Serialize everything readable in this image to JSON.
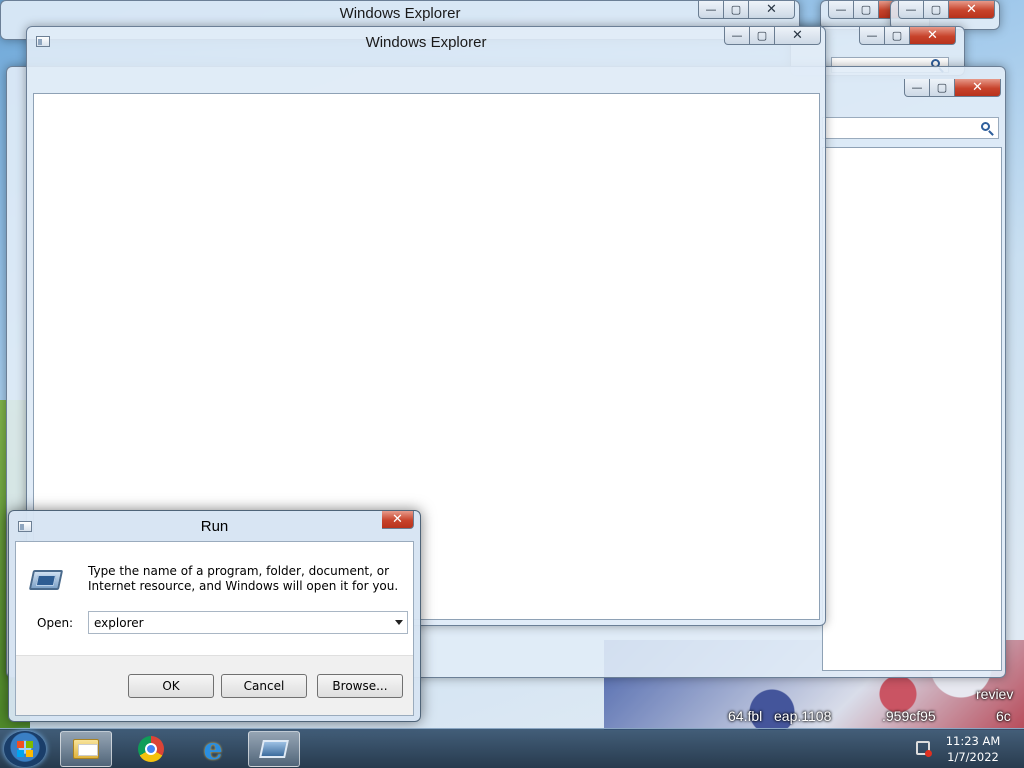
{
  "windows": [
    {
      "title": "Windows Explorer"
    },
    {
      "title": "Windows Explorer"
    }
  ],
  "window_controls": {
    "minimize": "—",
    "maximize": "▢",
    "close": "✕"
  },
  "desktop": {
    "snippet1": "64.fbl",
    "snippet2": "eap.1108",
    "snippet3": ".959cf95",
    "snippet4": "6c",
    "snippet5": "reviev"
  },
  "run_dialog": {
    "title": "Run",
    "message": "Type the name of a program, folder, document, or Internet resource, and Windows will open it for you.",
    "open_label": "Open:",
    "open_value": "explorer",
    "ok_label": "OK",
    "cancel_label": "Cancel",
    "browse_label": "Browse..."
  },
  "taskbar": {
    "items": [
      {
        "name": "windows-explorer",
        "icon": "folder-icon"
      },
      {
        "name": "google-chrome",
        "icon": "chrome-icon"
      },
      {
        "name": "internet-explorer",
        "icon": "ie-icon"
      },
      {
        "name": "run",
        "icon": "run-icon"
      }
    ],
    "ie_letter": "e",
    "clock_time": "11:23 AM",
    "clock_date": "1/7/2022"
  }
}
